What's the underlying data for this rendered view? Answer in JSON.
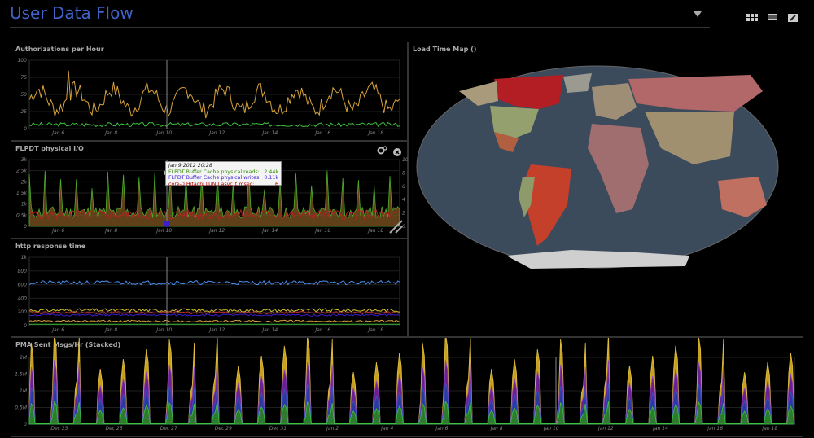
{
  "header": {
    "title": "User Data Flow",
    "icons": [
      "dropdown-arrow-icon",
      "grid-layout-icon",
      "monitor-icon",
      "edit-icon"
    ]
  },
  "panels": {
    "auth": {
      "title": "Authorizations per Hour",
      "y_ticks": [
        "100",
        "75",
        "50",
        "25",
        "0"
      ],
      "x_ticks": [
        "Jan 6",
        "Jan 8",
        "Jan 10",
        "Jan 12",
        "Jan 14",
        "Jan 16",
        "Jan 18"
      ]
    },
    "flpdt": {
      "title": "FLPDT physical I/O",
      "y_ticks": [
        "3k",
        "2.5k",
        "2k",
        "1.5k",
        "1k",
        "0.5k",
        "0"
      ],
      "y2_ticks": [
        "10",
        "8",
        "6",
        "4",
        "2",
        "0"
      ],
      "x_ticks": [
        "Jan 6",
        "Jan 8",
        "Jan 10",
        "Jan 12",
        "Jan 14",
        "Jan 16",
        "Jan 18"
      ],
      "tooltip": {
        "date": "Jan 9 2012 20:28",
        "rows": [
          {
            "label": "FLPDT Buffer Cache physical reads:",
            "value": "2.44k",
            "color": "#2e8b00"
          },
          {
            "label": "FLPDT Buffer Cache physical writes:",
            "value": "0.11k",
            "color": "#3a1fcf"
          },
          {
            "label": "core-0 Hitachi LUN0 asvc_t msec:",
            "value": "6",
            "color": "#b00000"
          }
        ]
      }
    },
    "http": {
      "title": "http response time",
      "y_ticks": [
        "1k",
        "800",
        "600",
        "400",
        "200",
        "0"
      ],
      "x_ticks": [
        "Jan 6",
        "Jan 8",
        "Jan 10",
        "Jan 12",
        "Jan 14",
        "Jan 16",
        "Jan 18"
      ]
    },
    "map": {
      "title": "Load Time Map ()"
    },
    "pma": {
      "title": "PMA Sent Msgs/Hr (Stacked)",
      "y_ticks": [
        "2M",
        "1.5M",
        "1M",
        "0.5M",
        "0"
      ],
      "x_ticks": [
        "Dec 23",
        "Dec 25",
        "Dec 27",
        "Dec 29",
        "Dec 31",
        "Jan 2",
        "Jan 4",
        "Jan 6",
        "Jan 8",
        "Jan 10",
        "Jan 12",
        "Jan 14",
        "Jan 16",
        "Jan 18"
      ]
    }
  }
}
